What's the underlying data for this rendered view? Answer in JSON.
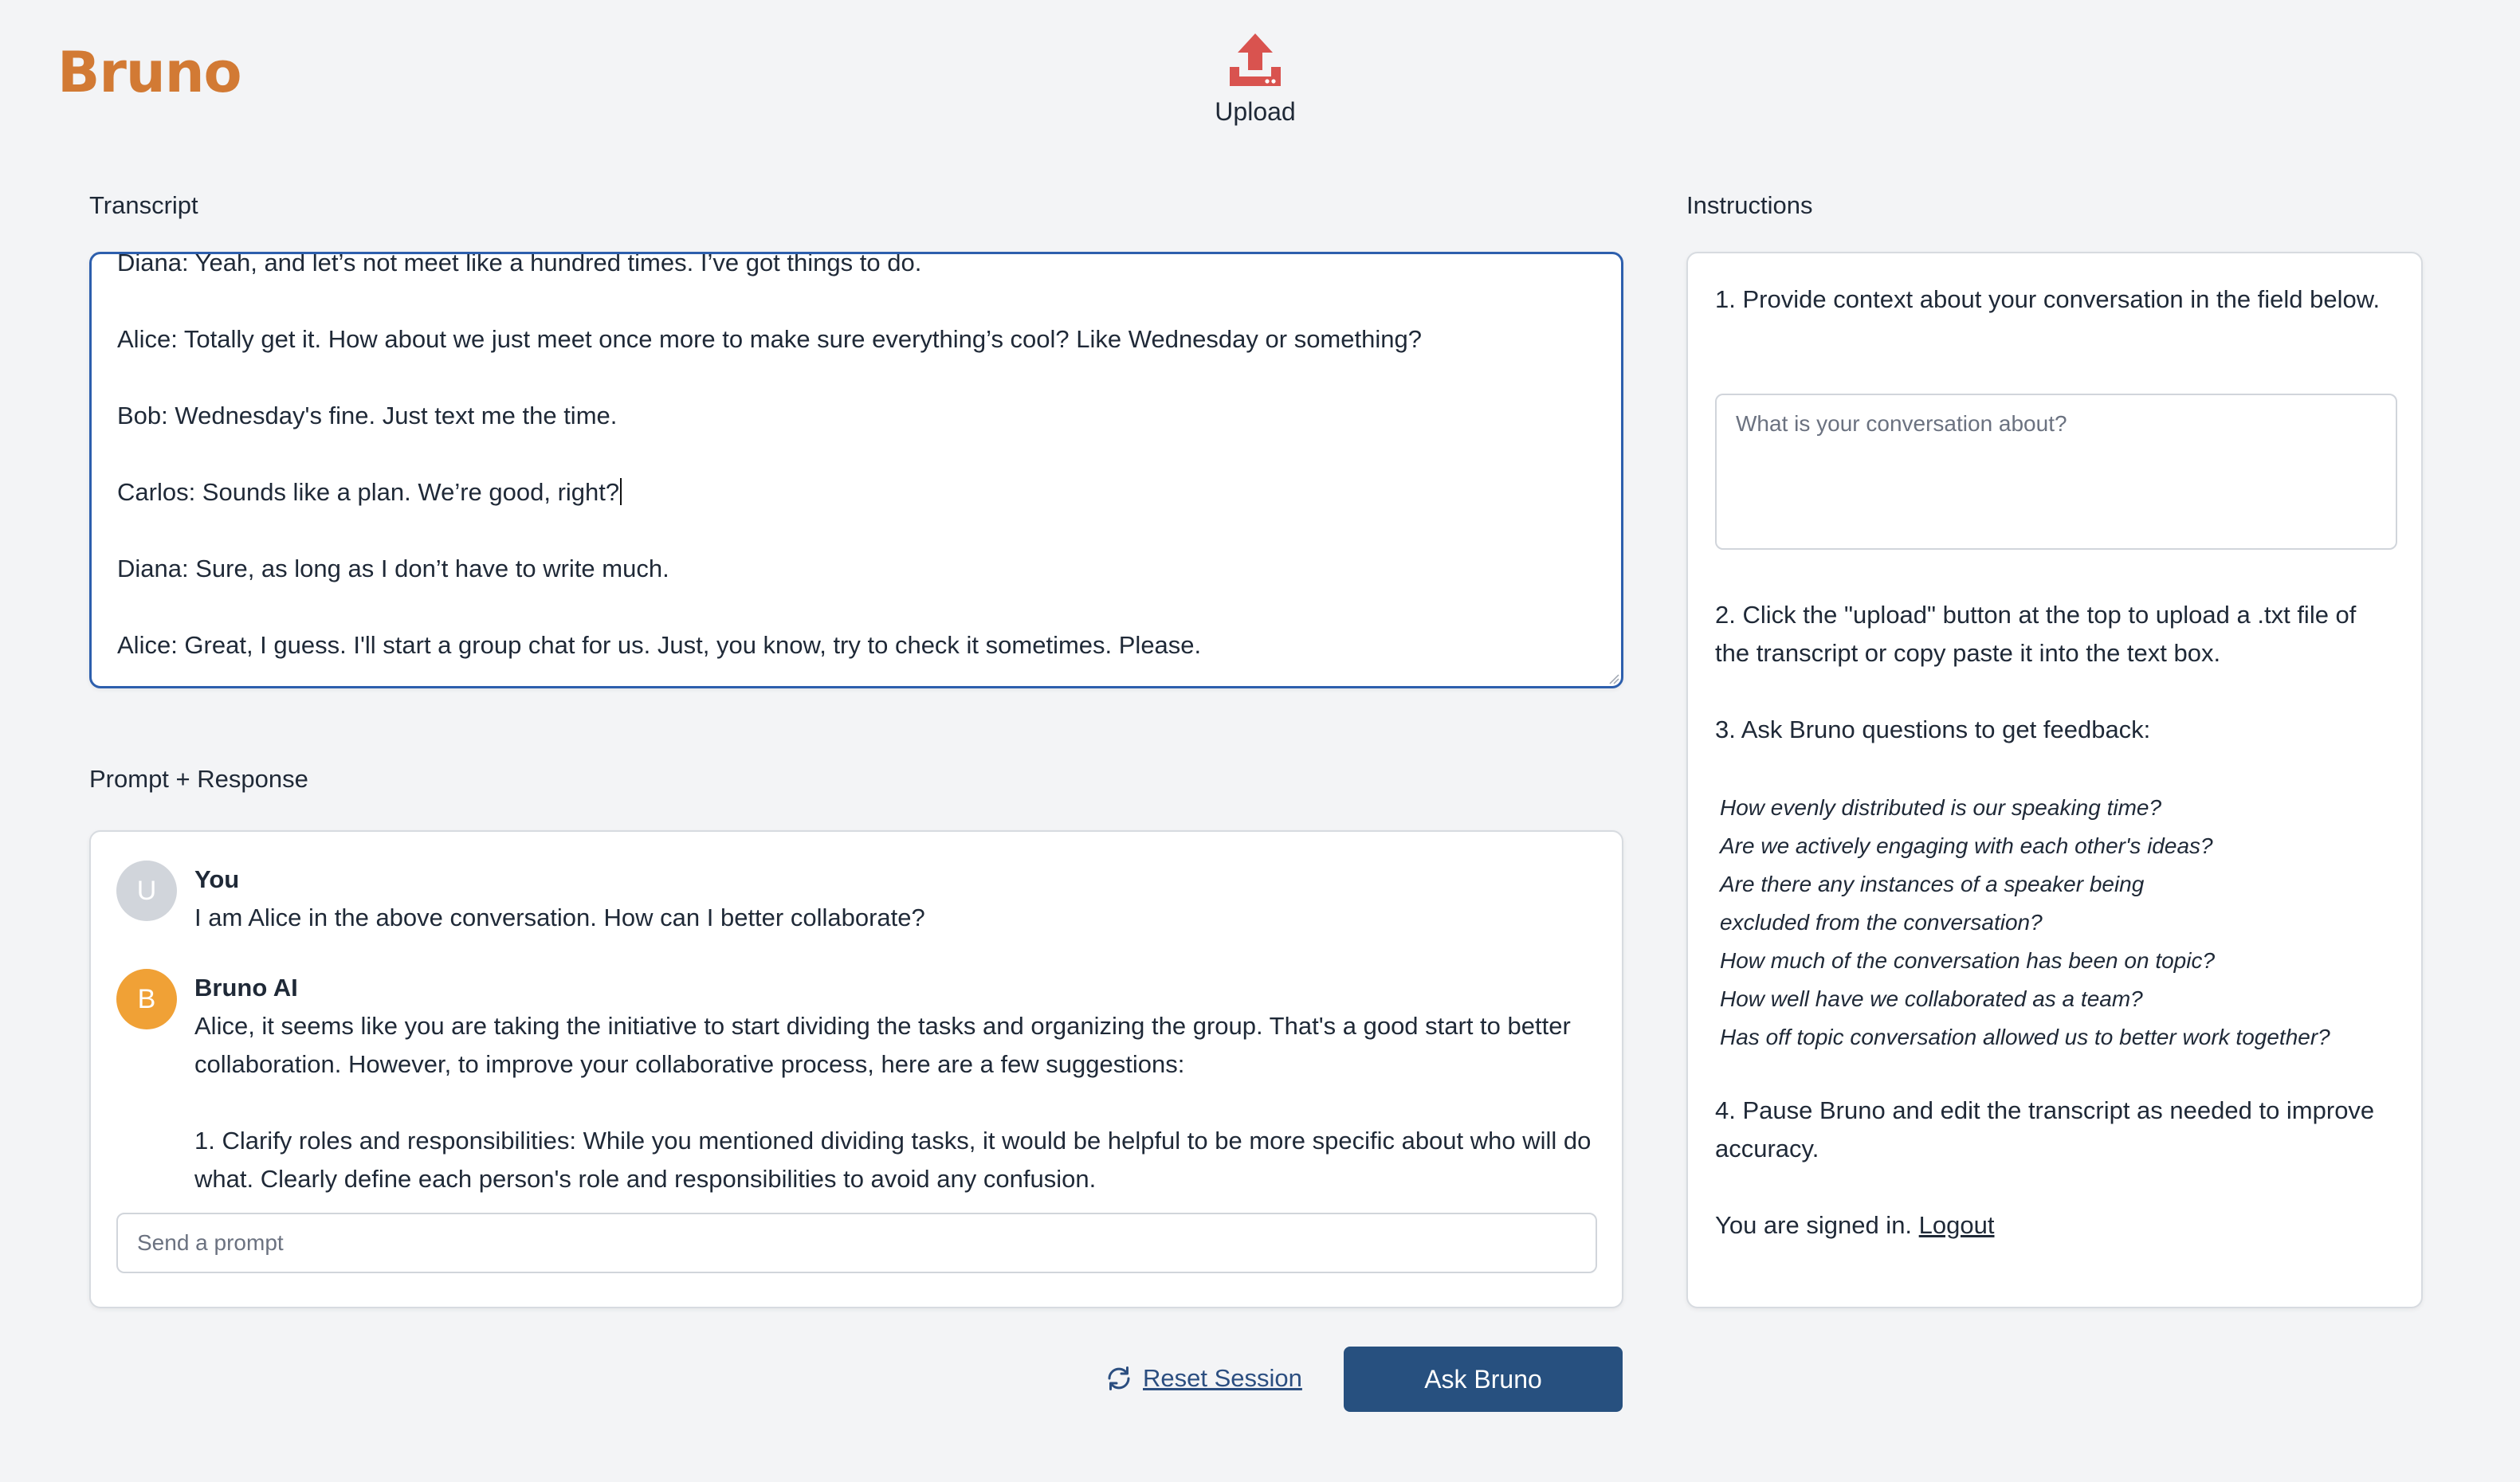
{
  "app": {
    "brand": "Bruno",
    "upload_label": "Upload",
    "colors": {
      "brand": "#d27a34",
      "upload_icon": "#d9534f",
      "primary_button": "#27507f",
      "ai_avatar": "#f0a136"
    }
  },
  "transcript": {
    "label": "Transcript",
    "lines": [
      "Diana: Yeah, and let’s not meet like a hundred times. I’ve got things to do.",
      "Alice: Totally get it. How about we just meet once more to make sure everything’s cool? Like Wednesday or something?",
      "Bob: Wednesday's fine. Just text me the time.",
      "Carlos: Sounds like a plan. We’re good, right?",
      "Diana: Sure, as long as I don’t have to write much.",
      "Alice: Great, I guess. I'll start a group chat for us. Just, you know, try to check it sometimes. Please."
    ]
  },
  "prompt_response": {
    "label": "Prompt + Response",
    "messages": [
      {
        "avatar": "U",
        "name": "You",
        "paragraphs": [
          "I am Alice in the above conversation. How can I better collaborate?"
        ]
      },
      {
        "avatar": "B",
        "name": "Bruno AI",
        "paragraphs": [
          "Alice, it seems like you are taking the initiative to start dividing the tasks and organizing the group. That's a good start to better collaboration. However, to improve your collaborative process, here are a few suggestions:",
          "1. Clarify roles and responsibilities: While you mentioned dividing tasks, it would be helpful to be more specific about who will do what. Clearly define each person's role and responsibilities to avoid any confusion."
        ]
      }
    ],
    "input_placeholder": "Send a prompt"
  },
  "actions": {
    "reset_label": "Reset Session",
    "ask_label": "Ask Bruno"
  },
  "instructions": {
    "label": "Instructions",
    "step1": "1. Provide context about your conversation in the field below.",
    "context_placeholder": "What is your conversation about?",
    "step2": "2. Click the \"upload\" button at the top to upload a .txt file of the transcript or copy paste it into the text box.",
    "step3": "3. Ask Bruno questions to get feedback:",
    "questions": [
      "How evenly distributed is our speaking time?",
      "Are we actively engaging with each other's ideas?",
      "Are there any instances of a speaker being",
      "excluded from the conversation?",
      "How much of the conversation has been on topic?",
      "How well have we collaborated as a team?",
      "Has off topic conversation allowed us to better work together?"
    ],
    "step4": "4. Pause Bruno and edit the transcript as needed to improve accuracy.",
    "signed_in": "You are signed in.",
    "logout_label": "Logout"
  }
}
